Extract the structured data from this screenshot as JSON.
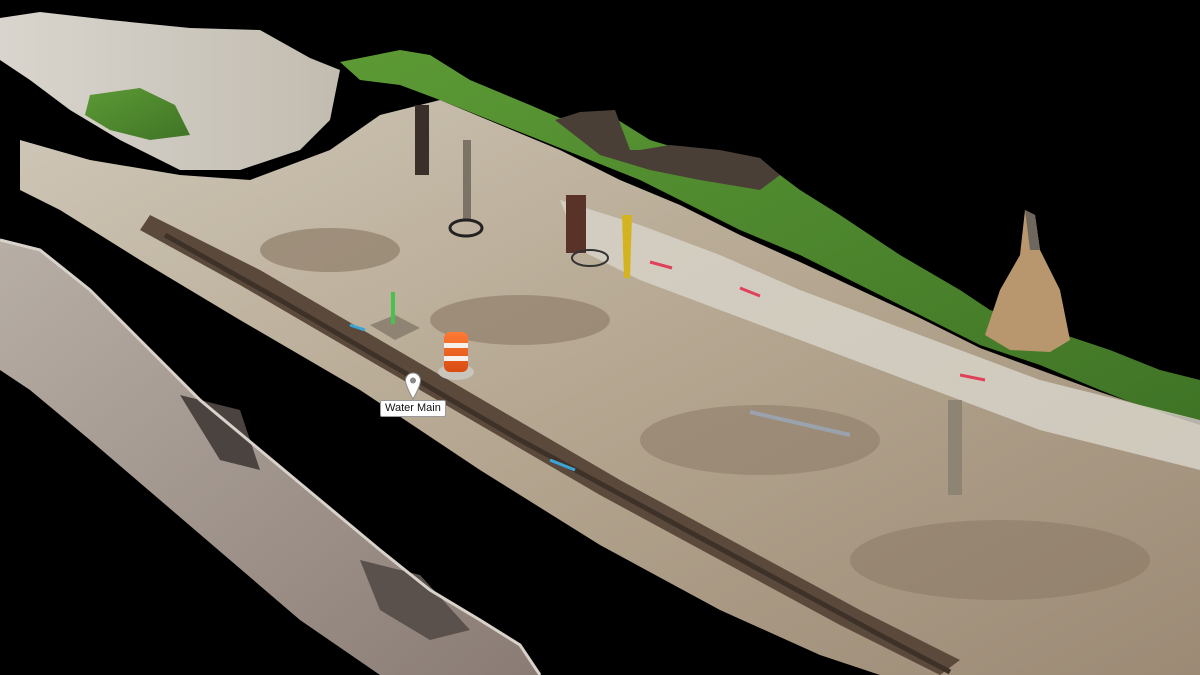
{
  "scene": {
    "background_color": "#000000",
    "terrain_colors": {
      "ground_light": "#c9c0ad",
      "ground_mid": "#a99a83",
      "ground_dark": "#6b5a4a",
      "grass": "#4f8a2e",
      "gravel": "#d6d3cc",
      "wall": "#9c8e86",
      "cone_orange": "#f05a1e"
    }
  },
  "markers": [
    {
      "label": "Water Main",
      "icon": "map-pin-icon"
    }
  ]
}
